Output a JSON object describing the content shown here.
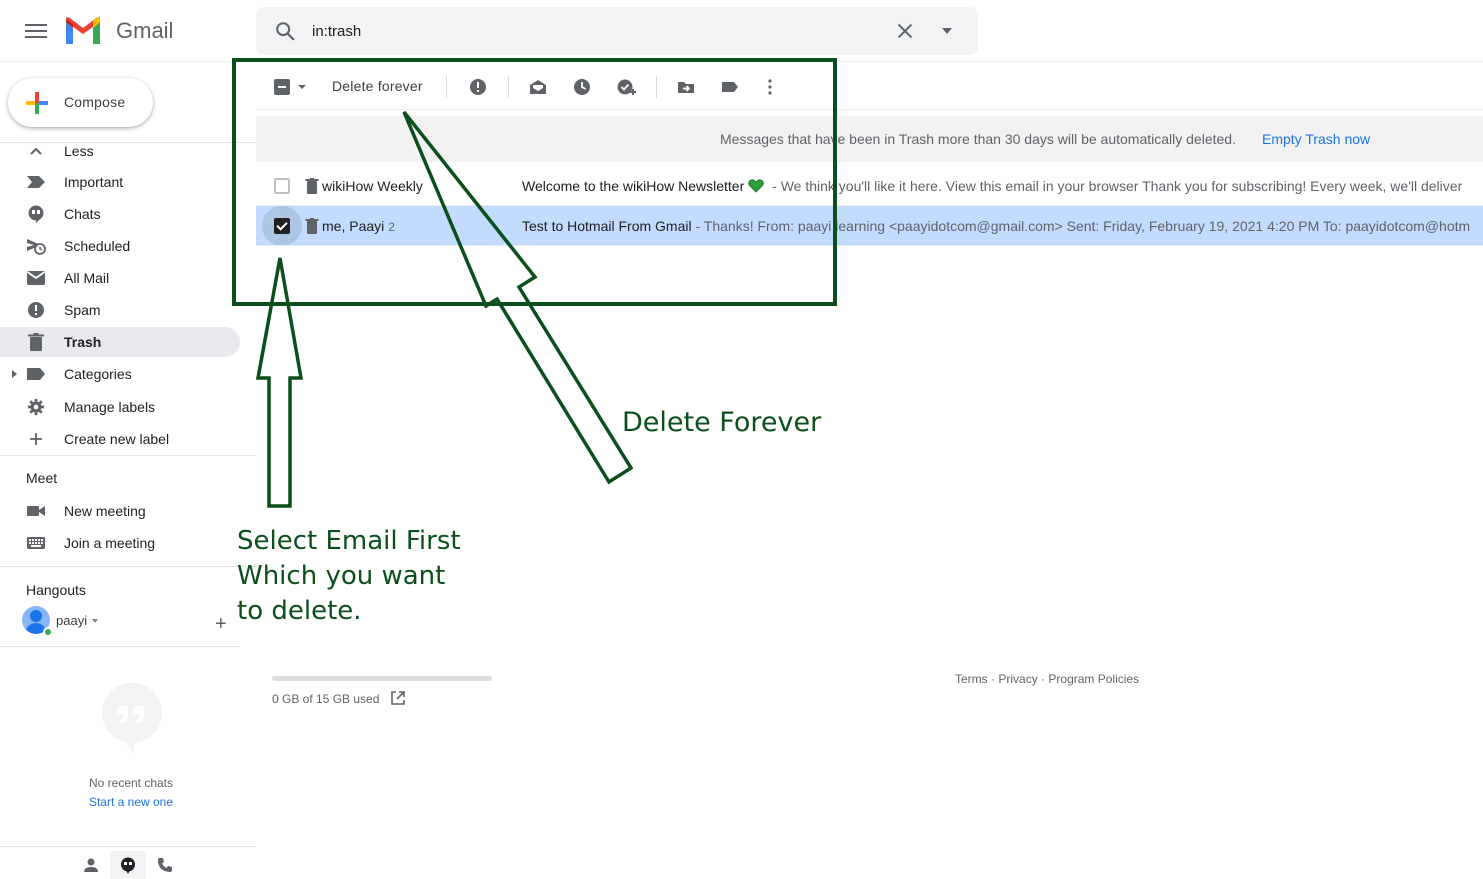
{
  "app": {
    "name": "Gmail"
  },
  "search": {
    "value": "in:trash"
  },
  "sidebar": {
    "compose_label": "Compose",
    "items": [
      {
        "label": "Less"
      },
      {
        "label": "Important"
      },
      {
        "label": "Chats"
      },
      {
        "label": "Scheduled"
      },
      {
        "label": "All Mail"
      },
      {
        "label": "Spam"
      },
      {
        "label": "Trash",
        "active": true
      },
      {
        "label": "Categories"
      },
      {
        "label": "Manage labels"
      },
      {
        "label": "Create new label"
      }
    ],
    "meet": {
      "title": "Meet",
      "items": [
        {
          "label": "New meeting"
        },
        {
          "label": "Join a meeting"
        }
      ]
    },
    "hangouts": {
      "title": "Hangouts",
      "user": "paayi",
      "empty_text": "No recent chats",
      "start_link": "Start a new one"
    }
  },
  "toolbar": {
    "delete_forever": "Delete forever"
  },
  "infobar": {
    "message": "Messages that have been in Trash more than 30 days will be automatically deleted.",
    "action": "Empty Trash now"
  },
  "emails": [
    {
      "sender": "wikiHow Weekly",
      "count": "",
      "subject": "Welcome to the wikiHow Newsletter",
      "snippet": " - We think you'll like it here. View this email in your browser Thank you for subscribing! Every week, we'll deliver",
      "selected": false
    },
    {
      "sender": "me, Paayi",
      "count": "2",
      "subject": "Test to Hotmail From Gmail",
      "snippet": " - Thanks! From: paayi learning <paayidotcom@gmail.com> Sent: Friday, February 19, 2021 4:20 PM To: paayidotcom@hotm",
      "selected": true
    }
  ],
  "footer": {
    "storage": "0 GB of 15 GB used",
    "storage_fraction": 0.0,
    "terms": "Terms",
    "privacy": "Privacy",
    "policies": "Program Policies",
    "sep": "·"
  },
  "annotations": {
    "delete_label": "Delete Forever",
    "select_line1": "Select Email First",
    "select_line2": "Which you want",
    "select_line3": "to delete."
  },
  "colors": {
    "annotation": "#0b4f1c",
    "selected_row": "#c2dbff",
    "link": "#1a73e8"
  }
}
